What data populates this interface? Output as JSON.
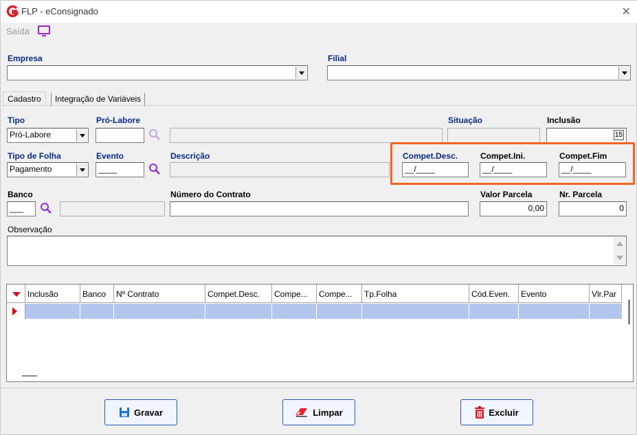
{
  "window": {
    "title": "FLP - eConsignado"
  },
  "toolbar": {
    "exit_label": "Saída"
  },
  "empresa": {
    "label": "Empresa",
    "value": ""
  },
  "filial": {
    "label": "Filial",
    "value": ""
  },
  "tabs": [
    {
      "label": "Cadastro",
      "active": true
    },
    {
      "label": "Integração de Variáveis",
      "active": false
    }
  ],
  "form": {
    "tipo": {
      "label": "Tipo",
      "value": "Pró-Labore"
    },
    "prolabore": {
      "label": "Pró-Labore",
      "value": "",
      "desc": ""
    },
    "situacao": {
      "label": "Situação",
      "value": ""
    },
    "inclusao": {
      "label": "Inclusão",
      "value": "",
      "cal": "15"
    },
    "tipo_folha": {
      "label": "Tipo de Folha",
      "value": "Pagamento"
    },
    "evento": {
      "label": "Evento",
      "value": "____"
    },
    "descricao": {
      "label": "Descrição",
      "value": ""
    },
    "compet_desc": {
      "label": "Compet.Desc.",
      "value": "__/____"
    },
    "compet_ini": {
      "label": "Compet.Ini.",
      "value": "__/____"
    },
    "compet_fim": {
      "label": "Compet.Fim",
      "value": "__/____"
    },
    "banco": {
      "label": "Banco",
      "value": "___",
      "name": ""
    },
    "numero_contrato": {
      "label": "Número do Contrato",
      "value": ""
    },
    "valor_parcela": {
      "label": "Valor Parcela",
      "value": "0,00"
    },
    "nr_parcela": {
      "label": "Nr. Parcela",
      "value": "0"
    },
    "observacao": {
      "label": "Observação",
      "value": ""
    }
  },
  "grid": {
    "columns": [
      "Inclusão",
      "Banco",
      "Nº Contrato",
      "Compet.Desc.",
      "Compe...",
      "Compe...",
      "Tp.Folha",
      "Cód.Even.",
      "Evento",
      "Vlr.Par"
    ]
  },
  "buttons": {
    "gravar": "Gravar",
    "limpar": "Limpar",
    "excluir": "Excluir"
  },
  "colors": {
    "label_blue": "#0a2a82",
    "highlight": "#f26522",
    "row_selected": "#b3c7ee",
    "magnifier": "#8a2be2"
  }
}
